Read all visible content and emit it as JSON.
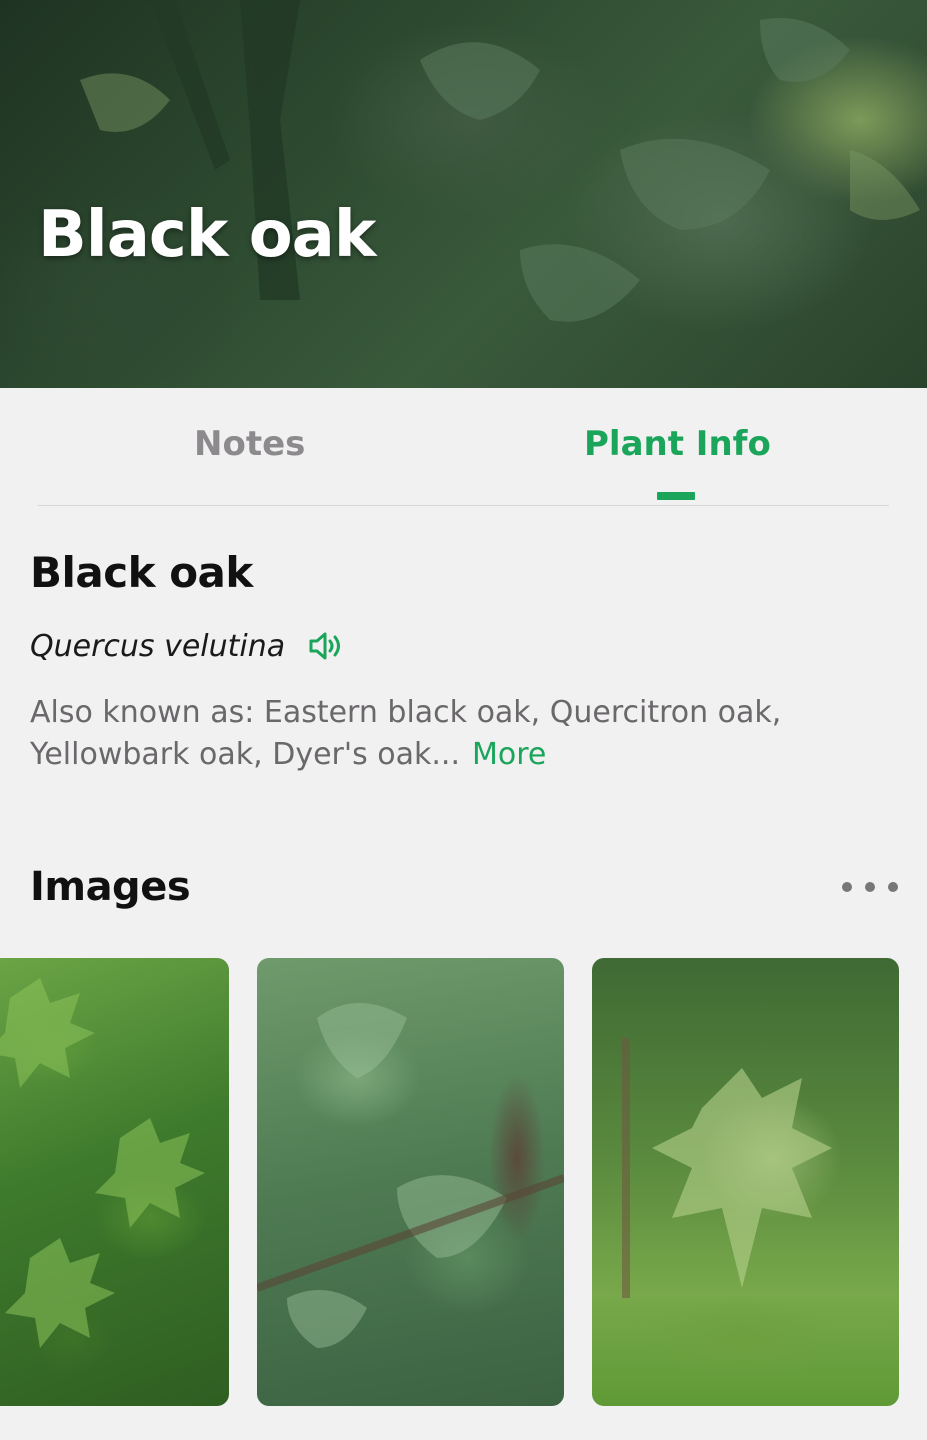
{
  "hero": {
    "title": "Black oak"
  },
  "tabs": [
    {
      "label": "Notes"
    },
    {
      "label": "Plant Info"
    }
  ],
  "active_tab": "Plant Info",
  "plant": {
    "common_name": "Black oak",
    "scientific_name": "Quercus velutina",
    "also_known_as": "Also known as: Eastern black oak, Quercitron oak, Yellowbark oak, Dyer's oak...",
    "more_label": "More"
  },
  "images_section": {
    "heading": "Images",
    "menu_icon": "more-dots-icon"
  },
  "icons": {
    "pronounce": "speaker-icon"
  },
  "colors": {
    "accent": "#1aa55a",
    "muted_text": "#6a686a",
    "background": "#f2f1f2"
  }
}
